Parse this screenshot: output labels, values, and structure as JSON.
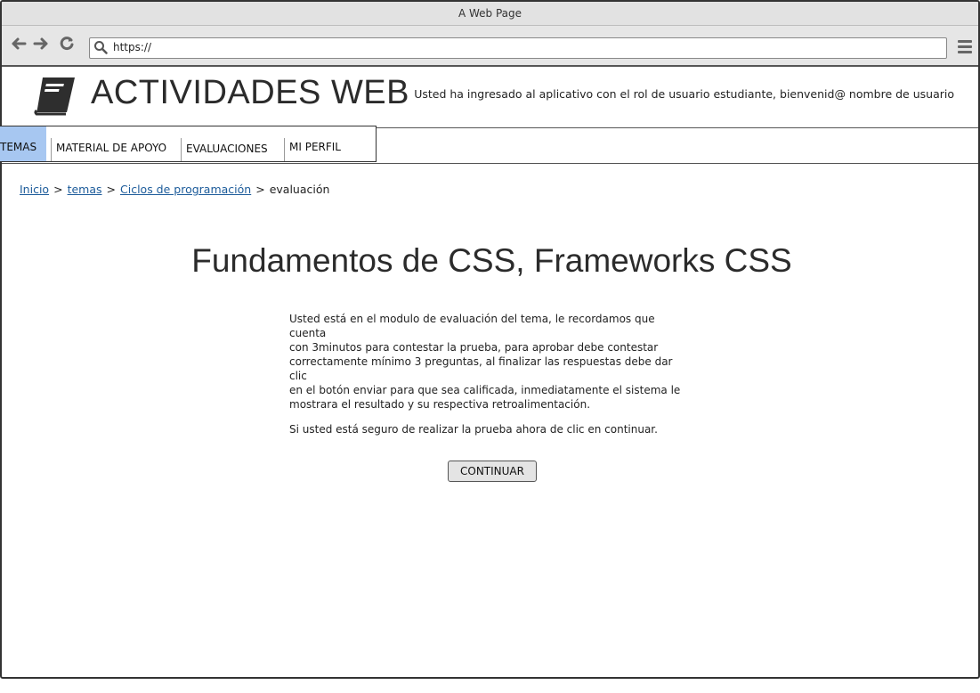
{
  "window": {
    "title": "A Web Page"
  },
  "browser": {
    "url": "https://",
    "back_icon": "arrow-left-icon",
    "forward_icon": "arrow-right-icon",
    "reload_icon": "reload-icon",
    "menu_icon": "hamburger-menu-icon"
  },
  "header": {
    "logo_icon": "book-icon",
    "app_title": "ACTIVIDADES WEB",
    "welcome": "Usted ha ingresado al aplicativo con el rol de usuario estudiante, bienvenid@ nombre de usuario"
  },
  "tabs": [
    {
      "label": "TEMAS",
      "active": true
    },
    {
      "label": "MATERIAL DE APOYO",
      "active": false
    },
    {
      "label": "EVALUACIONES",
      "active": false
    },
    {
      "label": "MI PERFIL",
      "active": false
    }
  ],
  "breadcrumb": {
    "items": [
      "Inicio",
      "temas",
      "Ciclos de programación"
    ],
    "current": "evaluación",
    "separator": ">"
  },
  "main": {
    "title": "Fundamentos de CSS, Frameworks CSS",
    "paragraph_lines": [
      "Usted está en el modulo de evaluación del tema, le recordamos que cuenta",
      "con 3minutos para contestar la prueba, para aprobar debe contestar",
      "correctamente mínimo 3 preguntas, al finalizar las respuestas debe dar clic",
      "en el botón enviar para que sea calificada, inmediatamente el sistema le",
      "mostrara el resultado y su respectiva retroalimentación."
    ],
    "confirm_text": "Si usted está seguro de realizar la prueba ahora de clic en continuar.",
    "continue_label": "CONTINUAR"
  },
  "colors": {
    "active_tab": "#a7c7f1",
    "link": "#1c5b9a"
  }
}
